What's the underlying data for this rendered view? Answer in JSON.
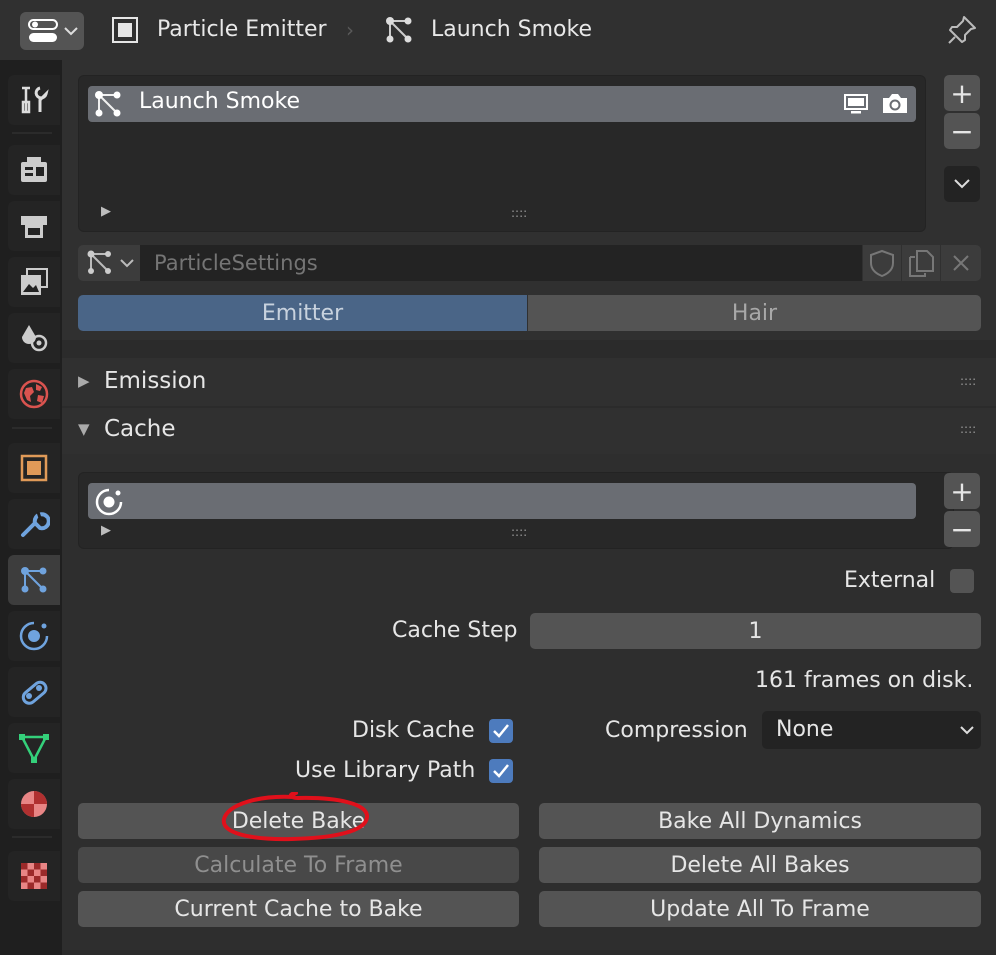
{
  "header": {
    "context_label": "Particle Emitter",
    "system_label": "Launch Smoke",
    "icons": [
      "editor-type-icon",
      "object-icon",
      "particles-icon",
      "pin-icon"
    ]
  },
  "sidebar": {
    "tabs": [
      {
        "name": "tool-tab",
        "icon": "tool-icon"
      },
      {
        "name": "render-tab",
        "icon": "render-icon"
      },
      {
        "name": "output-tab",
        "icon": "output-icon"
      },
      {
        "name": "view-layer-tab",
        "icon": "view-layer-icon"
      },
      {
        "name": "scene-tab",
        "icon": "scene-icon"
      },
      {
        "name": "world-tab",
        "icon": "world-icon"
      },
      {
        "name": "object-tab",
        "icon": "object-icon"
      },
      {
        "name": "modifiers-tab",
        "icon": "wrench-icon"
      },
      {
        "name": "particles-tab",
        "icon": "particles-icon",
        "active": true
      },
      {
        "name": "physics-tab",
        "icon": "physics-icon"
      },
      {
        "name": "constraints-tab",
        "icon": "constraints-icon"
      },
      {
        "name": "data-tab",
        "icon": "mesh-data-icon"
      },
      {
        "name": "material-tab",
        "icon": "material-icon"
      },
      {
        "name": "texture-tab",
        "icon": "texture-icon"
      }
    ]
  },
  "particle_list": {
    "items": [
      {
        "label": "Launch Smoke"
      }
    ]
  },
  "settings_block": {
    "name_placeholder": "ParticleSettings"
  },
  "type_tabs": {
    "emitter": "Emitter",
    "hair": "Hair",
    "selected": "Emitter"
  },
  "panels": {
    "emission": "Emission",
    "cache": "Cache"
  },
  "cache": {
    "external_label": "External",
    "external_checked": false,
    "cache_step_label": "Cache Step",
    "cache_step_value": "1",
    "status_text": "161 frames on disk.",
    "disk_cache_label": "Disk Cache",
    "disk_cache_checked": true,
    "compression_label": "Compression",
    "compression_value": "None",
    "use_library_path_label": "Use Library Path",
    "use_library_path_checked": true
  },
  "buttons": {
    "delete_bake": "Delete Bake",
    "calculate_to_frame": "Calculate To Frame",
    "current_cache_to_bake": "Current Cache to Bake",
    "bake_all_dynamics": "Bake All Dynamics",
    "delete_all_bakes": "Delete All Bakes",
    "update_all_to_frame": "Update All To Frame"
  },
  "colors": {
    "accent_blue": "#4d7bbd",
    "selected_tab": "#4a6587",
    "highlight_red": "#e0101b"
  }
}
